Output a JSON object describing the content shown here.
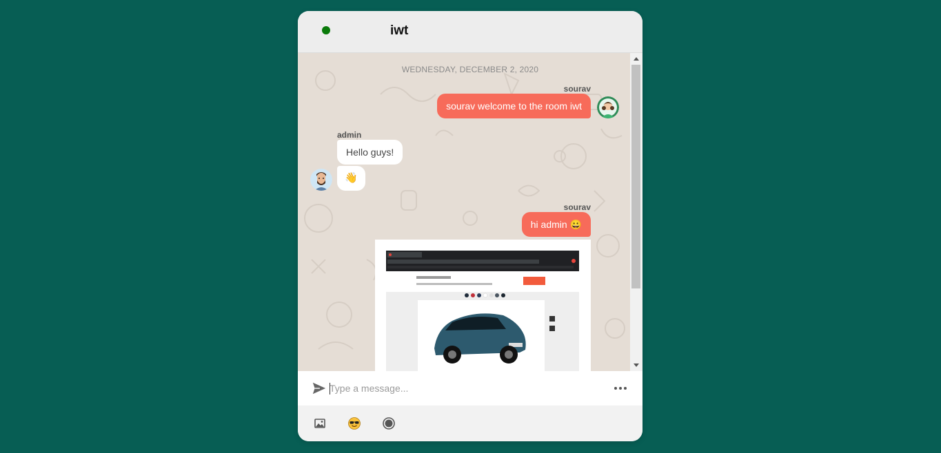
{
  "header": {
    "room_name": "iwt",
    "status_color": "#0a7a0a"
  },
  "messages": {
    "date_separator": "WEDNESDAY, DECEMBER 2, 2020",
    "items": [
      {
        "sender": "sourav",
        "direction": "outgoing",
        "text": "sourav welcome to the room iwt"
      },
      {
        "sender": "admin",
        "direction": "incoming",
        "text": "Hello guys!"
      },
      {
        "sender": "admin",
        "direction": "incoming",
        "text": "👋",
        "icon": "waving-hand-emoji"
      },
      {
        "sender": "sourav",
        "direction": "outgoing",
        "text": "hi admin 😀"
      },
      {
        "sender": "sourav",
        "direction": "outgoing",
        "type": "image",
        "icon": "car-screenshot-image"
      }
    ]
  },
  "composer": {
    "placeholder": "Type a message...",
    "value": ""
  },
  "toolbar": {
    "icons": [
      "image-icon",
      "sunglasses-emoji-icon",
      "record-icon"
    ]
  },
  "colors": {
    "background": "#075e54",
    "outgoing_bubble": "#f76b5a",
    "incoming_bubble": "#ffffff",
    "chat_wallpaper": "#e5ddd5"
  }
}
